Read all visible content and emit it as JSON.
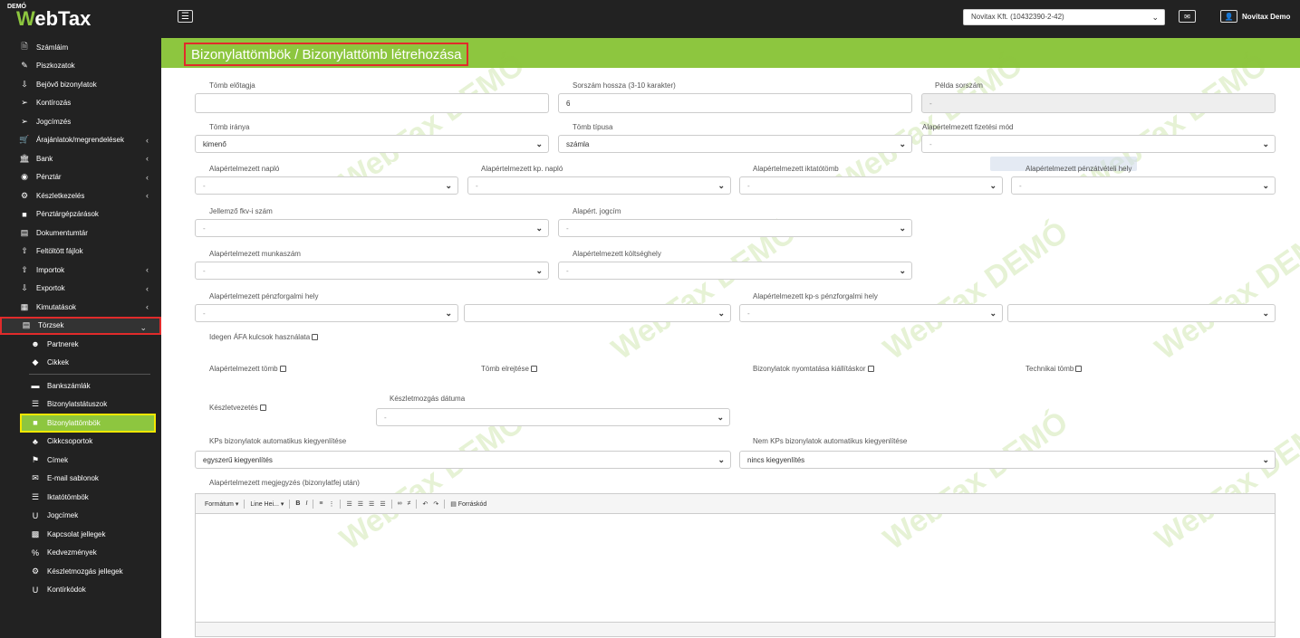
{
  "app": {
    "logo_demo": "DEMÓ",
    "logo_w": "W",
    "logo_rest": "ebTax",
    "company_select": "Novitax Kft. (10432390-2-42)",
    "user_name": "Novitax Demo",
    "accent_color": "#8dc63f"
  },
  "sidebar": {
    "items": [
      {
        "label": "Számláim",
        "icon": "file-icon"
      },
      {
        "label": "Piszkozatok",
        "icon": "draft-icon"
      },
      {
        "label": "Bejövő bizonylatok",
        "icon": "incoming-icon"
      },
      {
        "label": "Kontírozás",
        "icon": "posting-icon"
      },
      {
        "label": "Jogcímzés",
        "icon": "title-icon"
      },
      {
        "label": "Árajánlatok/megrendelések",
        "icon": "cart-icon"
      },
      {
        "label": "Bank",
        "icon": "bank-icon"
      },
      {
        "label": "Pénztár",
        "icon": "cash-icon"
      },
      {
        "label": "Készletkezelés",
        "icon": "stock-icon"
      },
      {
        "label": "Pénztárgépzárások",
        "icon": "lock-icon"
      },
      {
        "label": "Dokumentumtár",
        "icon": "archive-icon"
      },
      {
        "label": "Feltöltött fájlok",
        "icon": "upload-icon"
      },
      {
        "label": "Importok",
        "icon": "import-icon"
      },
      {
        "label": "Exportok",
        "icon": "export-icon"
      },
      {
        "label": "Kimutatások",
        "icon": "report-icon"
      },
      {
        "label": "Törzsek",
        "icon": "folder-icon"
      }
    ],
    "sub_items": [
      {
        "label": "Partnerek",
        "icon": "partners-icon"
      },
      {
        "label": "Cikkek",
        "icon": "items-icon"
      },
      {
        "label": "Bankszámlák",
        "icon": "bank-account-icon"
      },
      {
        "label": "Bizonylatstátuszok",
        "icon": "list-icon"
      },
      {
        "label": "Bizonylattömbök",
        "icon": "folder-icon"
      },
      {
        "label": "Cikkcsoportok",
        "icon": "groups-icon"
      },
      {
        "label": "Címek",
        "icon": "address-icon"
      },
      {
        "label": "E-mail sablonok",
        "icon": "mail-icon"
      },
      {
        "label": "Iktatótömbök",
        "icon": "stack-icon"
      },
      {
        "label": "Jogcímek",
        "icon": "u-icon"
      },
      {
        "label": "Kapcsolat jellegek",
        "icon": "card-icon"
      },
      {
        "label": "Kedvezmények",
        "icon": "percent-icon"
      },
      {
        "label": "Készletmozgás jellegek",
        "icon": "stock-move-icon"
      },
      {
        "label": "Kontírkódok",
        "icon": "u-icon"
      }
    ]
  },
  "page": {
    "title": "Bizonylattömbök / Bizonylattömb létrehozása"
  },
  "form": {
    "tomb_elotagja_label": "Tömb előtagja",
    "tomb_elotagja_value": "",
    "sorszam_hossza_label": "Sorszám hossza (3-10 karakter)",
    "sorszam_hossza_value": "6",
    "pelda_sorszam_label": "Példa sorszám",
    "pelda_sorszam_value": "-",
    "tomb_iranya_label": "Tömb iránya",
    "tomb_iranya_value": "kimenő",
    "tomb_tipusa_label": "Tömb típusa",
    "tomb_tipusa_value": "számla",
    "fizetesi_mod_label": "Alapértelmezett fizetési mód",
    "fizetesi_mod_value": "-",
    "naplo_label": "Alapértelmezett napló",
    "naplo_value": "-",
    "kp_naplo_label": "Alapértelmezett kp. napló",
    "kp_naplo_value": "-",
    "iktatotomb_label": "Alapértelmezett iktatótömb",
    "iktatotomb_value": "-",
    "penzatveteli_label": "Alapértelmezett pénzátvételi hely",
    "penzatveteli_value": "-",
    "fkv_label": "Jellemző fkv-i szám",
    "fkv_value": "-",
    "jogcim_label": "Alapért. jogcím",
    "jogcim_value": "-",
    "munkaszam_label": "Alapértelmezett munkaszám",
    "munkaszam_value": "-",
    "koltseghely_label": "Alapértelmezett költséghely",
    "koltseghely_value": "-",
    "penzforgalmi_label": "Alapértelmezett pénzforgalmi hely",
    "penzforgalmi_value1": "-",
    "penzforgalmi_value2": "",
    "kp_penzforgalmi_label": "Alapértelmezett kp-s pénzforgalmi hely",
    "kp_penzforgalmi_value1": "-",
    "kp_penzforgalmi_value2": "",
    "idegen_afa_label": "Idegen ÁFA kulcsok használata",
    "alapertelmezett_tomb_label": "Alapértelmezett tömb",
    "tomb_elrejtese_label": "Tömb elrejtése",
    "nyomtatas_label": "Bizonylatok nyomtatása kiállításkor",
    "technikai_tomb_label": "Technikai tömb",
    "keszletvezetes_label": "Készletvezetés",
    "keszletmozgas_datuma_label": "Készletmozgás dátuma",
    "keszletmozgas_datuma_value": "-",
    "kps_kiegyenlites_label": "KPs bizonylatok automatikus kiegyenlítése",
    "kps_kiegyenlites_value": "egyszerű kiegyenlítés",
    "nem_kps_kiegyenlites_label": "Nem KPs bizonylatok automatikus kiegyenlítése",
    "nem_kps_kiegyenlites_value": "nincs kiegyenlítés",
    "megjegyzes_label": "Alapértelmezett megjegyzés (bizonylatfej után)"
  },
  "editor_toolbar": {
    "format": "Formátum",
    "line_height": "Line Hei...",
    "bold": "B",
    "italic": "I",
    "source": "Forráskód"
  },
  "watermark": "WebTax DEMÓ"
}
